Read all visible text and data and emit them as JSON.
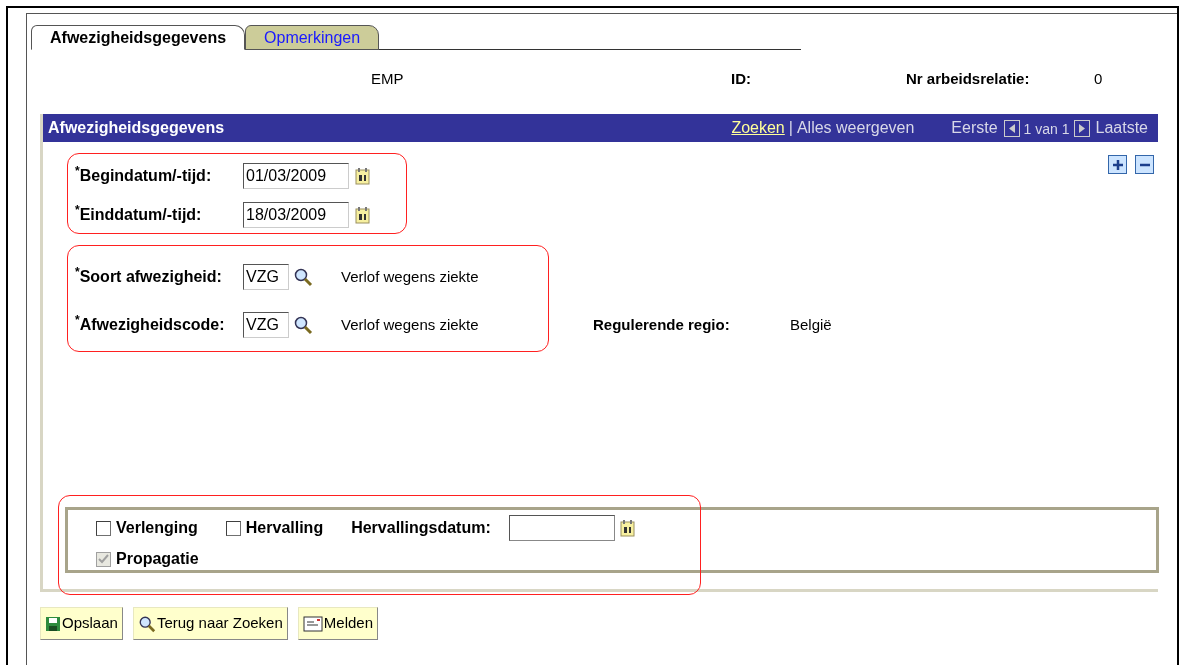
{
  "tabs": [
    {
      "label": "Afwezigheidsgegevens",
      "selected": true
    },
    {
      "label": "Opmerkingen",
      "selected": false
    }
  ],
  "header": {
    "name": "EMP",
    "id_label": "ID:",
    "relation_label": "Nr arbeidsrelatie:",
    "relation_value": "0"
  },
  "panel": {
    "title": "Afwezigheidsgegevens",
    "search_link": "Zoeken",
    "separator": "|",
    "show_all": "Alles weergeven",
    "first": "Eerste",
    "counter": "1 van 1",
    "last": "Laatste"
  },
  "date_fields": [
    {
      "label": "$^{*}$Begindatum/-tijd:",
      "value": "01/03/2009"
    },
    {
      "label": "$^{*}$Einddatum/-tijd:",
      "value": "18/03/2009"
    }
  ],
  "code_fields": [
    {
      "label": "$^{*}$Soort afwezigheid:",
      "value": "VZG",
      "description": "Verlof wegens ziekte"
    },
    {
      "label": "$^{*}$Afwezigheidscode:",
      "value": "VZG",
      "description": "Verlof wegens ziekte"
    }
  ],
  "region": {
    "label": "Regulerende regio:",
    "value": "België"
  },
  "option_rows": [
    [
      {
        "kind": "checkbox",
        "label": "Verlenging",
        "checked": false,
        "disabled": false
      },
      {
        "kind": "checkbox",
        "label": "Hervalling",
        "checked": false,
        "disabled": false
      },
      {
        "kind": "date",
        "label": "Hervallingsdatum:"
      }
    ],
    [
      {
        "kind": "checkbox",
        "label": "Propagatie",
        "checked": true,
        "disabled": true
      }
    ]
  ],
  "buttons": [
    {
      "label": "Opslaan",
      "kind": "save"
    },
    {
      "label": "Terug naar Zoeken",
      "kind": "search"
    },
    {
      "label": "Melden",
      "kind": "notify"
    }
  ]
}
